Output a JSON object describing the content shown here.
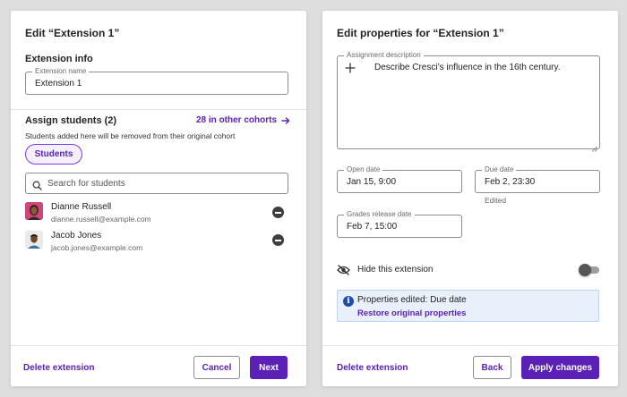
{
  "left": {
    "title": "Edit “Extension 1”",
    "extension_info_heading": "Extension info",
    "extension_name_label": "Extension name",
    "extension_name_value": "Extension 1",
    "assign_heading": "Assign students (2)",
    "other_cohorts_link": "28 in other cohorts",
    "notice": "Students added here will be removed from their original cohort",
    "chip_label": "Students",
    "search_placeholder": "Search for students",
    "students": [
      {
        "name": "Dianne Russell",
        "email": "dianne.russell@example.com"
      },
      {
        "name": "Jacob Jones",
        "email": "jacob.jones@example.com"
      }
    ],
    "delete_label": "Delete extension",
    "cancel_label": "Cancel",
    "next_label": "Next"
  },
  "right": {
    "title": "Edit properties for “Extension 1”",
    "assignment_description_label": "Assignment description",
    "assignment_description_value": "Describe Cresci’s influence in the 16th century.",
    "open_date_label": "Open date",
    "open_date_value": "Jan 15, 9:00",
    "due_date_label": "Due date",
    "due_date_value": "Feb 2, 23:30",
    "due_date_helper": "Edited",
    "grades_release_label": "Grades release date",
    "grades_release_value": "Feb 7, 15:00",
    "hide_label": "Hide this extension",
    "hide_enabled": false,
    "info_text": "Properties edited: Due date",
    "restore_link": "Restore original properties",
    "delete_label": "Delete extension",
    "back_label": "Back",
    "apply_label": "Apply changes"
  },
  "colors": {
    "accent": "#5b21b6",
    "info_bg": "#e8f0fb",
    "info_icon": "#1e4fa8",
    "page_bg": "#dedede"
  },
  "icons": {
    "arrow": "arrow-right-icon",
    "search": "search-icon",
    "remove": "remove-circle-icon",
    "add": "plus-icon",
    "hide": "eye-off-icon",
    "info": "info-icon"
  }
}
